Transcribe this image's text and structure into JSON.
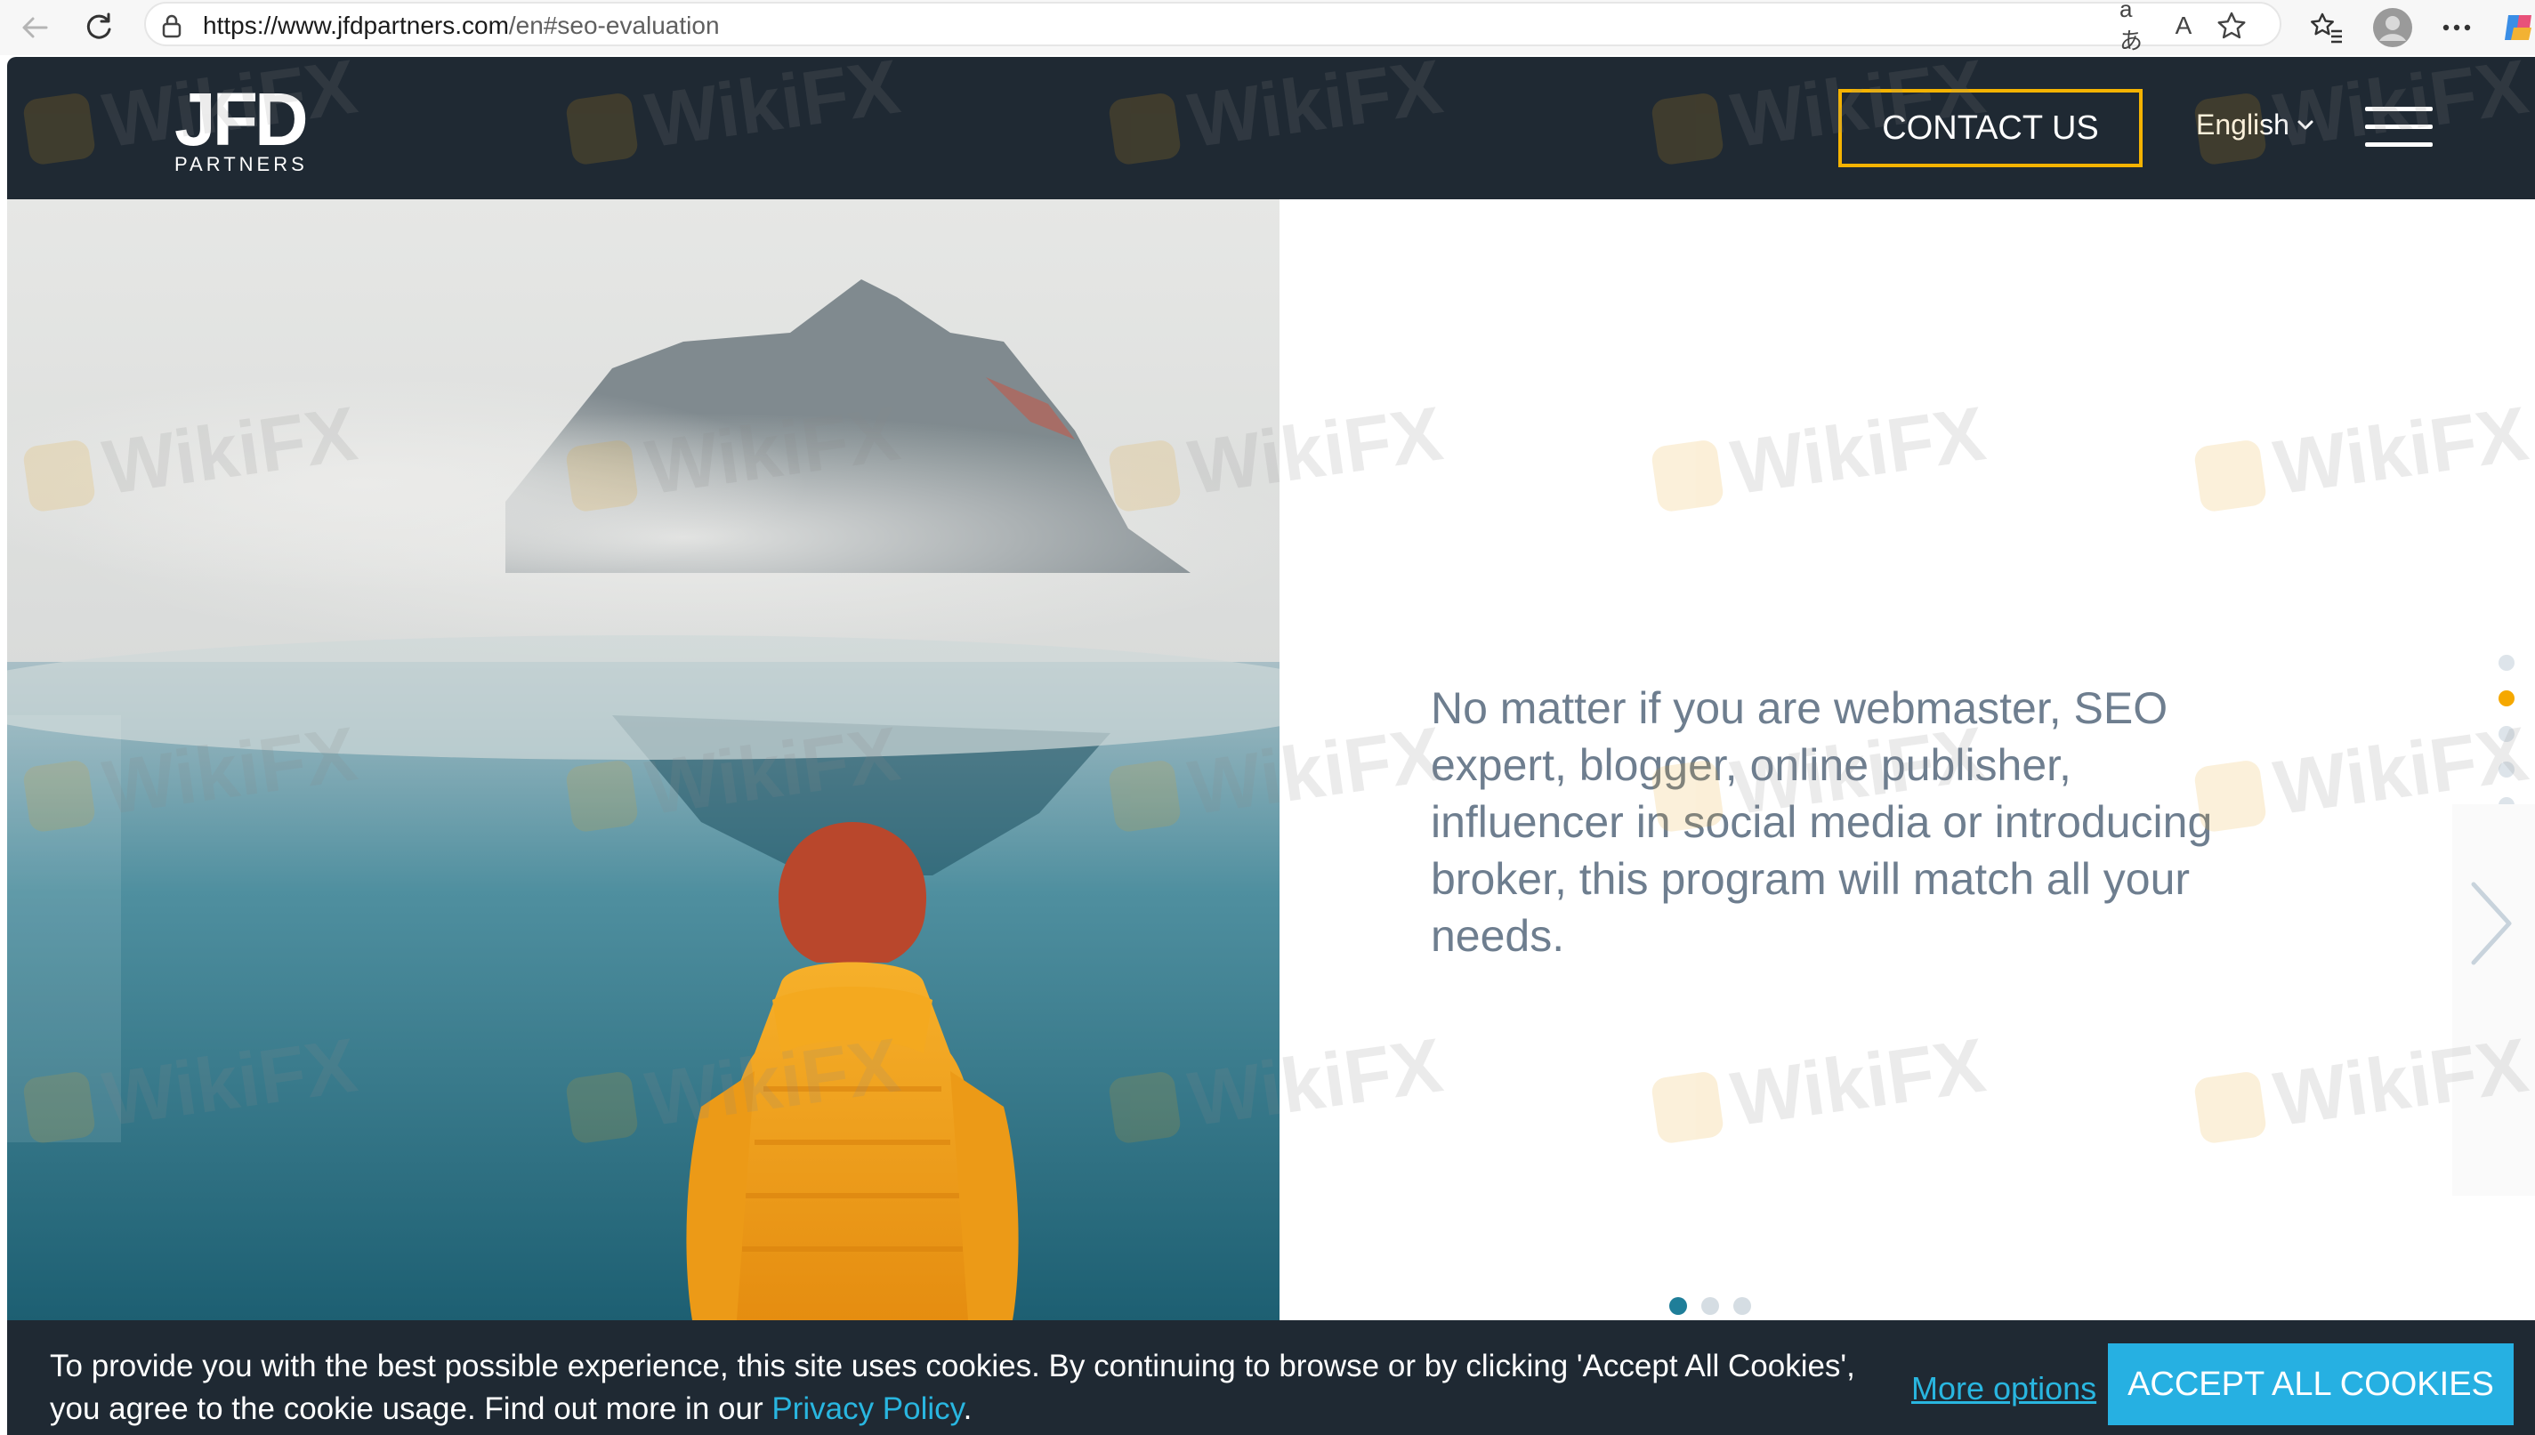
{
  "browser": {
    "url_host": "https://www.jfdpartners.com",
    "url_path": "/en#seo-evaluation",
    "translate_label": "aあ",
    "read_aloud_label": "A)"
  },
  "header": {
    "logo_mark": "JFD",
    "logo_sub": "PARTNERS",
    "contact_label": "CONTACT US",
    "language": "English"
  },
  "hero": {
    "text": "No matter if you are webmaster, SEO expert, blogger, online publisher, influencer in social media or introducing broker, this program will match all your needs.",
    "vertical_dots_count": 6,
    "vertical_active_index": 1,
    "slide_dots_count": 3,
    "slide_active_index": 0
  },
  "cookie": {
    "text_before_link": "To provide you with the best possible experience, this site uses cookies. By continuing to browse or by clicking 'Accept All Cookies', you agree to the cookie usage. Find out more in our ",
    "link_text": "Privacy Policy",
    "text_after_link": ".",
    "more_options": "More options",
    "accept_label": "ACCEPT ALL COOKIES"
  },
  "watermark": {
    "word": "WikiFX"
  },
  "colors": {
    "header_bg": "#1f2933",
    "accent_yellow": "#f5b301",
    "accept_blue": "#26b0e2",
    "link_blue": "#29b6e0",
    "hero_text": "#6e7e8f",
    "jacket": "#f3a21a"
  }
}
